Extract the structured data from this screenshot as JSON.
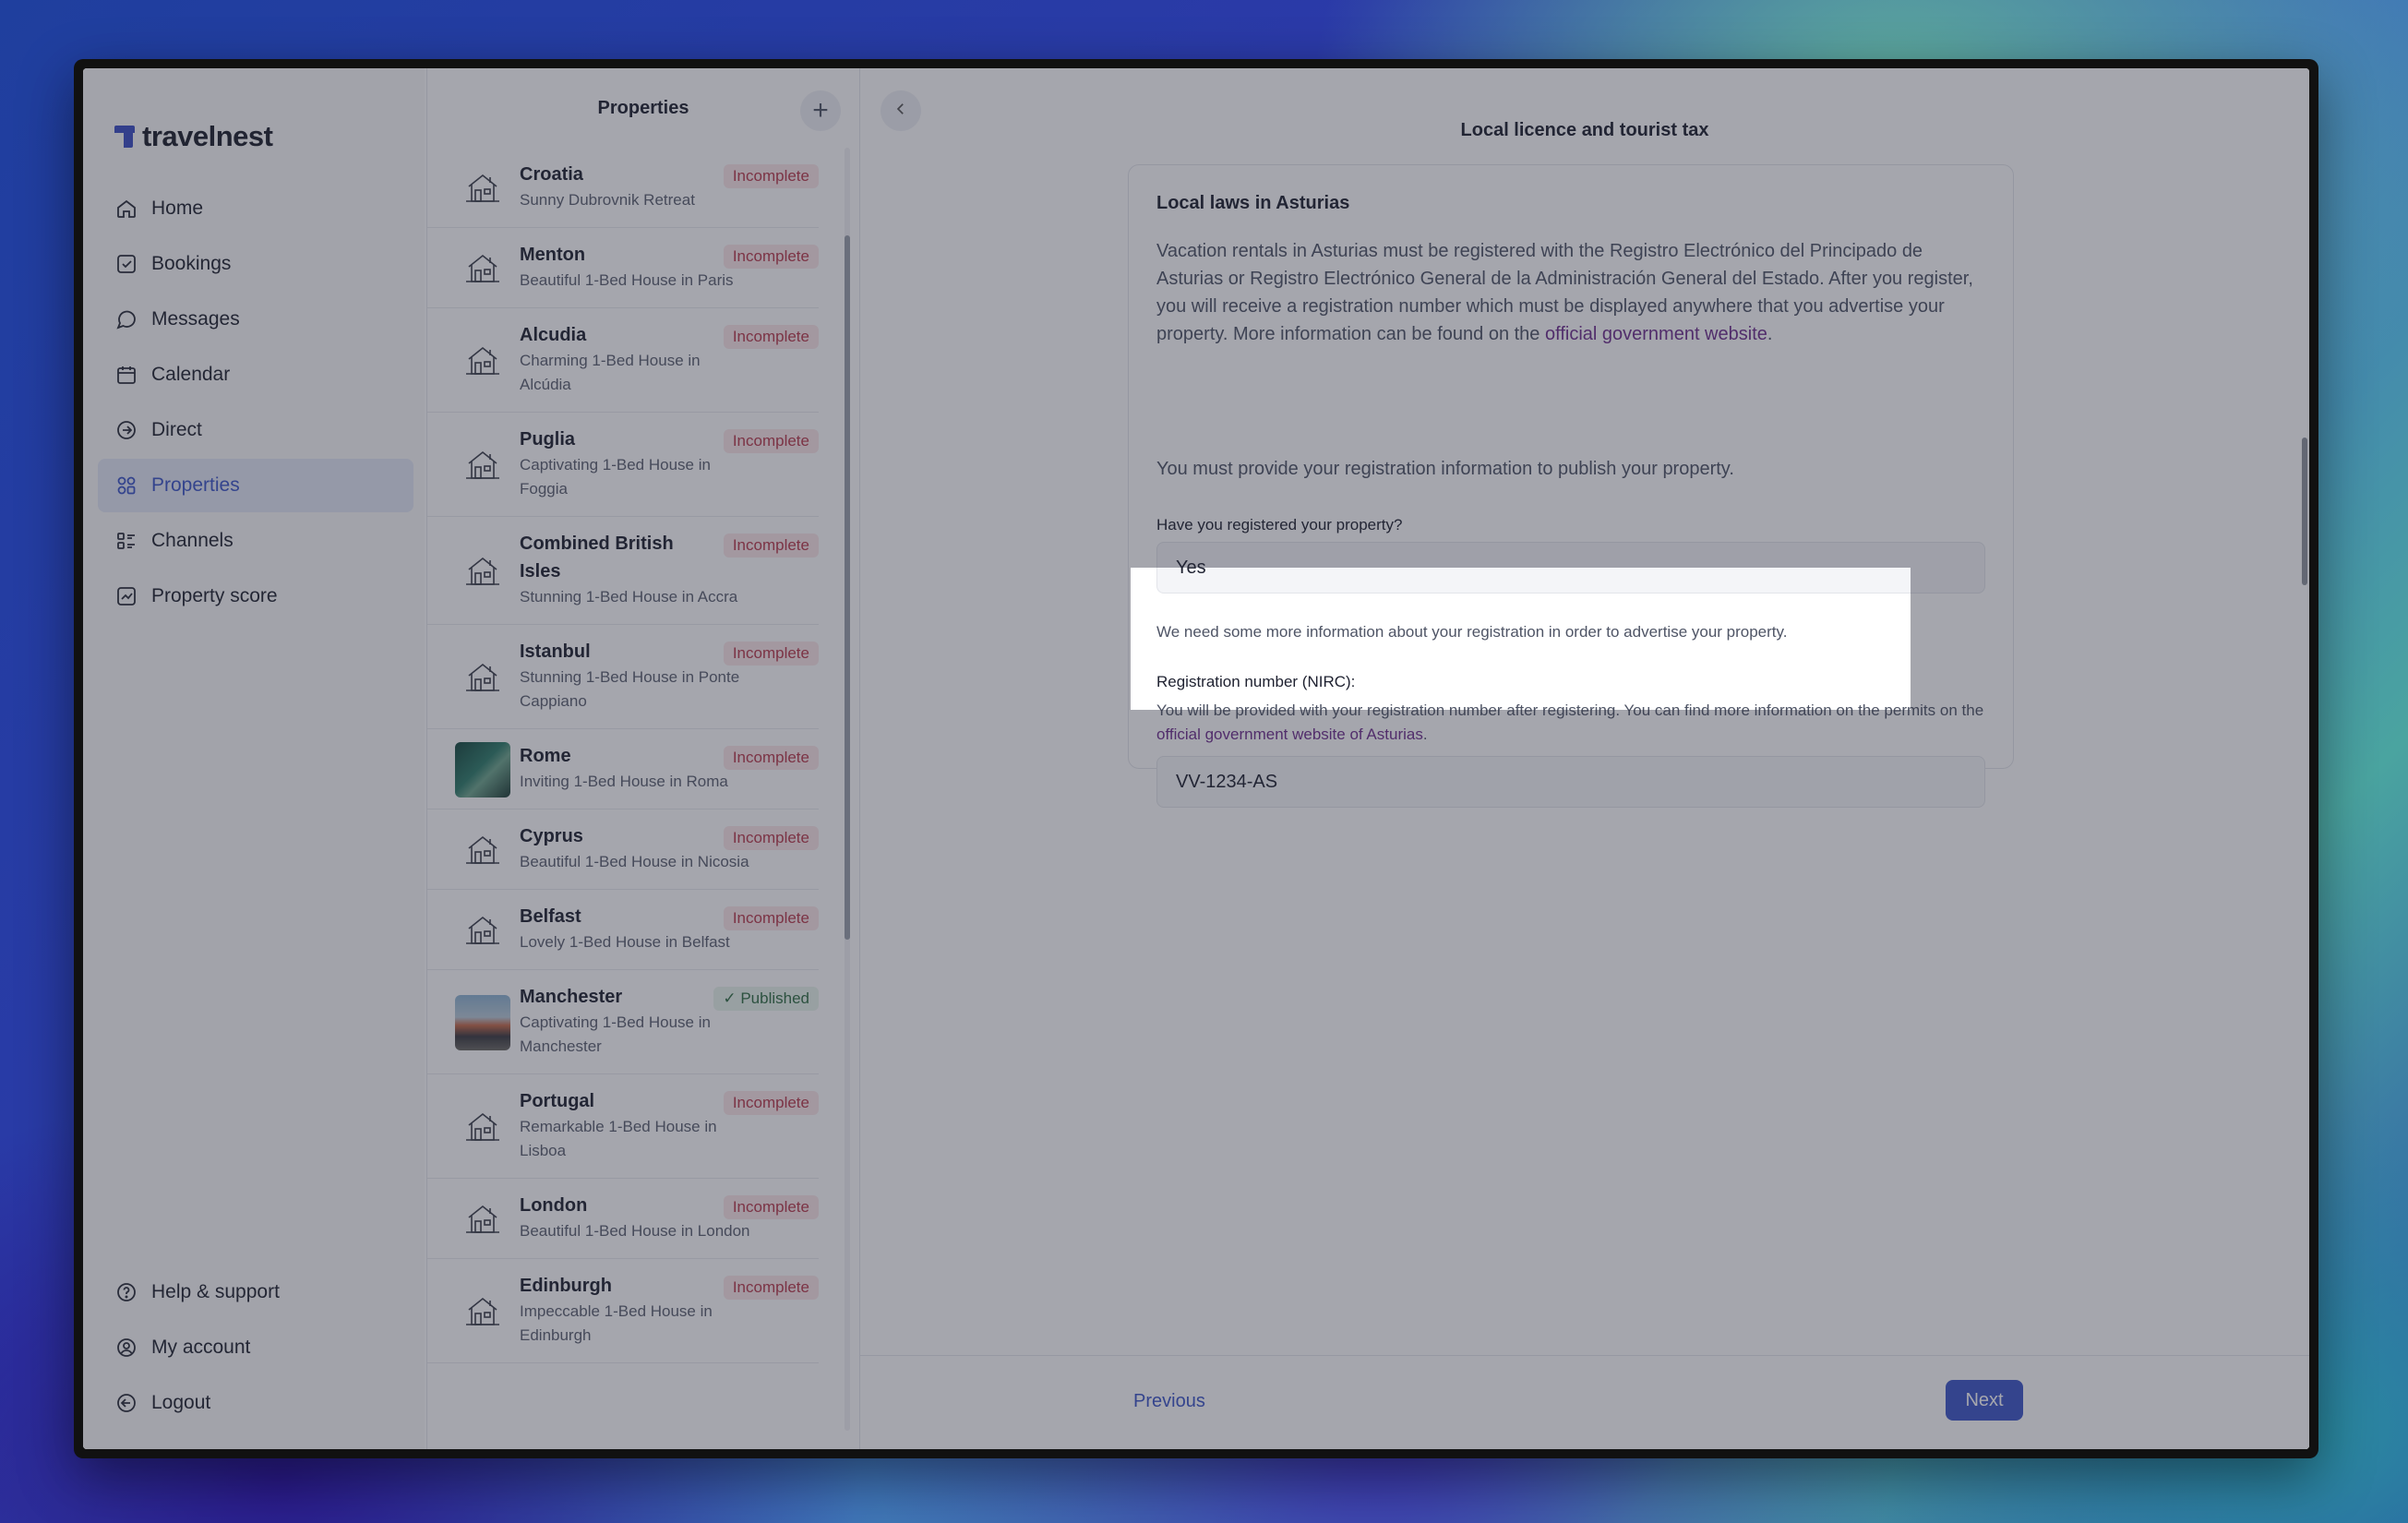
{
  "app": {
    "name": "travelnest"
  },
  "nav": {
    "items": [
      {
        "label": "Home",
        "icon": "home-icon"
      },
      {
        "label": "Bookings",
        "icon": "bookings-icon"
      },
      {
        "label": "Messages",
        "icon": "messages-icon"
      },
      {
        "label": "Calendar",
        "icon": "calendar-icon"
      },
      {
        "label": "Direct",
        "icon": "direct-icon"
      },
      {
        "label": "Properties",
        "icon": "properties-icon",
        "active": true
      },
      {
        "label": "Channels",
        "icon": "channels-icon"
      },
      {
        "label": "Property score",
        "icon": "property-score-icon"
      }
    ],
    "bottom": [
      {
        "label": "Help & support",
        "icon": "help-icon"
      },
      {
        "label": "My account",
        "icon": "account-icon"
      },
      {
        "label": "Logout",
        "icon": "logout-icon"
      }
    ]
  },
  "properties": {
    "title": "Properties",
    "items": [
      {
        "name": "Croatia",
        "subtitle": "Sunny Dubrovnik Retreat",
        "status": "Incomplete",
        "thumb": "house-icon"
      },
      {
        "name": "Menton",
        "subtitle": "Beautiful 1-Bed House in Paris",
        "status": "Incomplete",
        "thumb": "house-icon"
      },
      {
        "name": "Alcudia",
        "subtitle": "Charming 1-Bed House in Alcúdia",
        "status": "Incomplete",
        "thumb": "house-icon"
      },
      {
        "name": "Puglia",
        "subtitle": "Captivating 1-Bed House in Foggia",
        "status": "Incomplete",
        "thumb": "house-icon"
      },
      {
        "name": "Combined British Isles",
        "subtitle": "Stunning 1-Bed House in Accra",
        "status": "Incomplete",
        "thumb": "house-icon"
      },
      {
        "name": "Istanbul",
        "subtitle": "Stunning 1-Bed House in Ponte Cappiano",
        "status": "Incomplete",
        "thumb": "house-icon"
      },
      {
        "name": "Rome",
        "subtitle": "Inviting 1-Bed House in Roma",
        "status": "Incomplete",
        "thumb": "photo"
      },
      {
        "name": "Cyprus",
        "subtitle": "Beautiful 1-Bed House in Nicosia",
        "status": "Incomplete",
        "thumb": "house-icon"
      },
      {
        "name": "Belfast",
        "subtitle": "Lovely 1-Bed House in Belfast",
        "status": "Incomplete",
        "thumb": "house-icon"
      },
      {
        "name": "Manchester",
        "subtitle": "Captivating 1-Bed House in Manchester",
        "status": "Published",
        "thumb": "photo"
      },
      {
        "name": "Portugal",
        "subtitle": "Remarkable 1-Bed House in Lisboa",
        "status": "Incomplete",
        "thumb": "house-icon"
      },
      {
        "name": "London",
        "subtitle": "Beautiful 1-Bed House in London",
        "status": "Incomplete",
        "thumb": "house-icon"
      },
      {
        "name": "Edinburgh",
        "subtitle": "Impeccable 1-Bed House in Edinburgh",
        "status": "Incomplete",
        "thumb": "house-icon"
      }
    ]
  },
  "main": {
    "title": "Local licence and tourist tax",
    "card": {
      "title": "Local laws in Asturias",
      "paragraph_before": "Vacation rentals in Asturias must be registered with the Registro Electrónico del Principado de Asturias or Registro Electrónico General de la Administración General del Estado. After you register, you will receive a registration number which must be displayed anywhere that you advertise your property. More information can be found on the ",
      "paragraph_link": "official government website",
      "paragraph_after": ".",
      "must_provide": "You must provide your registration information to publish your property.",
      "registered_label": "Have you registered your property?",
      "registered_value": "Yes",
      "more_info_note": "We need some more information about your registration in order to advertise your property.",
      "reg_label": "Registration number (NIRC):",
      "reg_help_before": "You will be provided with your registration number after registering. You can find more information on the permits on the ",
      "reg_help_link": "official government website of Asturias",
      "reg_help_after": ".",
      "reg_value": "VV-1234-AS"
    },
    "footer": {
      "previous": "Previous",
      "next": "Next"
    }
  },
  "colors": {
    "accent": "#3d57c8",
    "link": "#6f2f8e",
    "incomplete": "#b83a4c",
    "published": "#2f6d43"
  }
}
